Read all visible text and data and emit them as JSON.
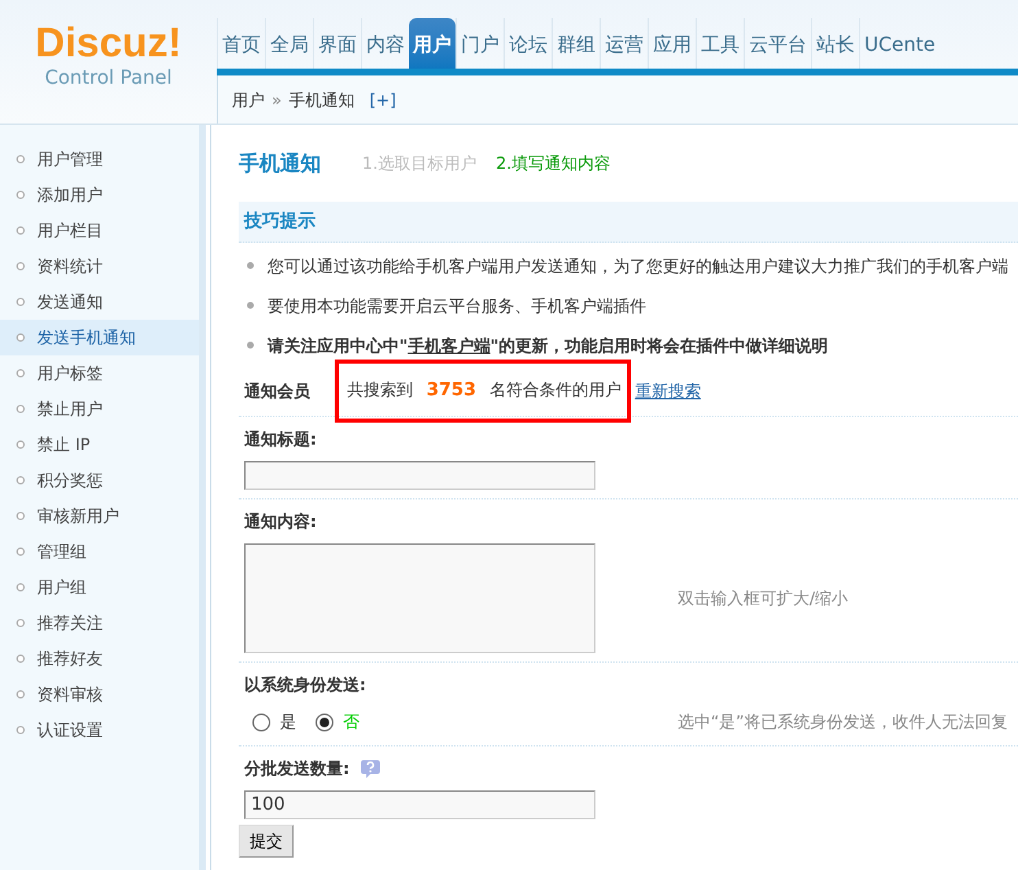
{
  "logo": {
    "name": "Discuz!",
    "subtitle": "Control Panel"
  },
  "nav": [
    {
      "label": "首页",
      "selected": false
    },
    {
      "label": "全局",
      "selected": false
    },
    {
      "label": "界面",
      "selected": false
    },
    {
      "label": "内容",
      "selected": false
    },
    {
      "label": "用户",
      "selected": true
    },
    {
      "label": "门户",
      "selected": false
    },
    {
      "label": "论坛",
      "selected": false
    },
    {
      "label": "群组",
      "selected": false
    },
    {
      "label": "运营",
      "selected": false
    },
    {
      "label": "应用",
      "selected": false
    },
    {
      "label": "工具",
      "selected": false
    },
    {
      "label": "云平台",
      "selected": false
    },
    {
      "label": "站长",
      "selected": false
    },
    {
      "label": "UCente",
      "selected": false
    }
  ],
  "breadcrumb": {
    "parts": [
      "用户",
      "手机通知"
    ],
    "separator": "»",
    "add": "[+]"
  },
  "sidebar": [
    {
      "label": "用户管理",
      "selected": false
    },
    {
      "label": "添加用户",
      "selected": false
    },
    {
      "label": "用户栏目",
      "selected": false
    },
    {
      "label": "资料统计",
      "selected": false
    },
    {
      "label": "发送通知",
      "selected": false
    },
    {
      "label": "发送手机通知",
      "selected": true
    },
    {
      "label": "用户标签",
      "selected": false
    },
    {
      "label": "禁止用户",
      "selected": false
    },
    {
      "label": "禁止 IP",
      "selected": false
    },
    {
      "label": "积分奖惩",
      "selected": false
    },
    {
      "label": "审核新用户",
      "selected": false
    },
    {
      "label": "管理组",
      "selected": false
    },
    {
      "label": "用户组",
      "selected": false
    },
    {
      "label": "推荐关注",
      "selected": false
    },
    {
      "label": "推荐好友",
      "selected": false
    },
    {
      "label": "资料审核",
      "selected": false
    },
    {
      "label": "认证设置",
      "selected": false
    }
  ],
  "page": {
    "title": "手机通知",
    "steps": [
      {
        "label": "1.选取目标用户",
        "selected": false
      },
      {
        "label": "2.填写通知内容",
        "selected": true
      }
    ]
  },
  "tips": {
    "title": "技巧提示",
    "items": [
      {
        "kind": "plain",
        "text": "您可以通过该功能给手机客户端用户发送通知，为了您更好的触达用户建议大力推广我们的手机客户端"
      },
      {
        "kind": "plain",
        "text": "要使用本功能需要开启云平台服务、手机客户端插件"
      },
      {
        "kind": "bold_link",
        "before": "请关注应用中心中\"",
        "link": "手机客户端",
        "after": "\"的更新，功能启用时将会在插件中做详细说明"
      }
    ]
  },
  "recipients": {
    "label": "通知会员",
    "before": "共搜索到",
    "count": "3753",
    "after": "名符合条件的用户",
    "link": "重新搜索",
    "highlighted": true
  },
  "form": [
    {
      "kind": "text",
      "label": "通知标题:"
    },
    {
      "kind": "textarea",
      "label": "通知内容:",
      "hint": "双击输入框可扩大/缩小"
    },
    {
      "kind": "radio",
      "label": "以系统身份发送:",
      "options": [
        {
          "label": "是",
          "selected": false
        },
        {
          "label": "否",
          "selected": true
        }
      ],
      "hint": "选中“是”将已系统身份发送，收件人无法回复"
    },
    {
      "kind": "text",
      "label": "分批发送数量:",
      "help": true,
      "value": "100"
    }
  ],
  "submit": "提交"
}
